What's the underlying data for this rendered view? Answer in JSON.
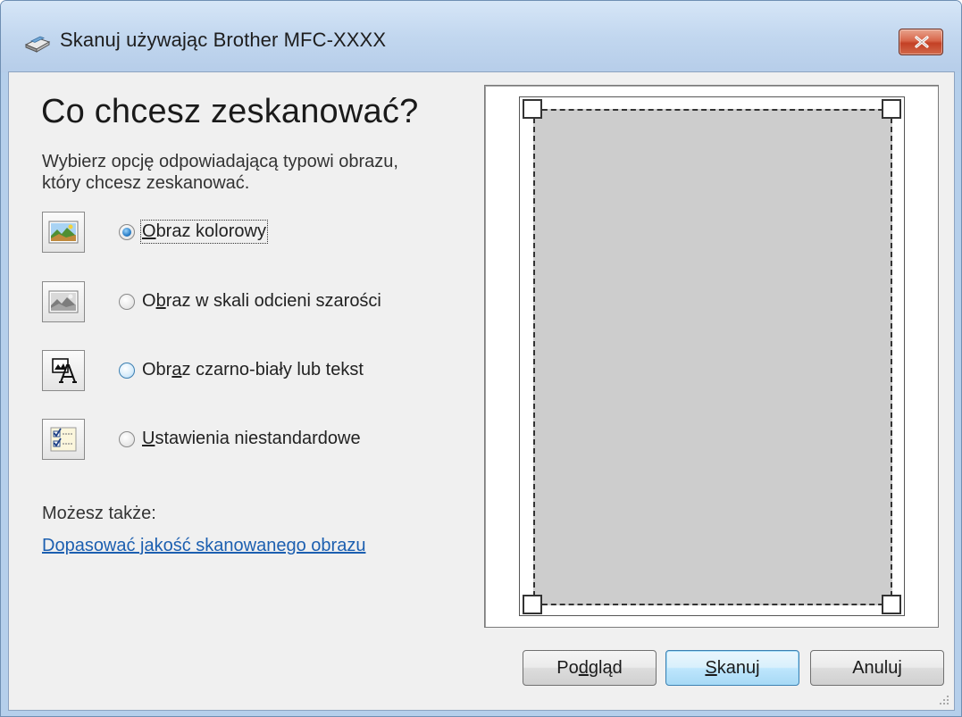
{
  "window": {
    "title": "Skanuj używając Brother MFC-XXXX"
  },
  "main": {
    "heading": "Co chcesz zeskanować?",
    "intro_line1": "Wybierz opcję odpowiadającą typowi obrazu,",
    "intro_line2": "który chcesz zeskanować.",
    "options": [
      {
        "mnemonic": "O",
        "rest": "braz kolorowy",
        "selected": true,
        "icon": "color-photo-icon"
      },
      {
        "pre": "O",
        "mnemonic": "b",
        "rest": "raz w skali odcieni szarości",
        "selected": false,
        "icon": "grayscale-photo-icon"
      },
      {
        "pre": "Obr",
        "mnemonic": "a",
        "rest": "z czarno-biały lub tekst",
        "selected": false,
        "icon": "black-white-text-icon"
      },
      {
        "mnemonic": "U",
        "rest": "stawienia niestandardowe",
        "selected": false,
        "icon": "custom-settings-icon"
      }
    ],
    "also_label": "Możesz także:",
    "adjust_link": "Dopasować jakość skanowanego obrazu"
  },
  "buttons": {
    "preview": {
      "pre": "Po",
      "mnemonic": "d",
      "rest": "gląd"
    },
    "scan": {
      "mnemonic": "S",
      "rest": "kanuj"
    },
    "cancel": "Anuluj"
  },
  "colors": {
    "titlebar": "#c2d7ef",
    "close_button": "#c34025",
    "link": "#1c5fb0",
    "scan_area": "#cdcdcd"
  }
}
